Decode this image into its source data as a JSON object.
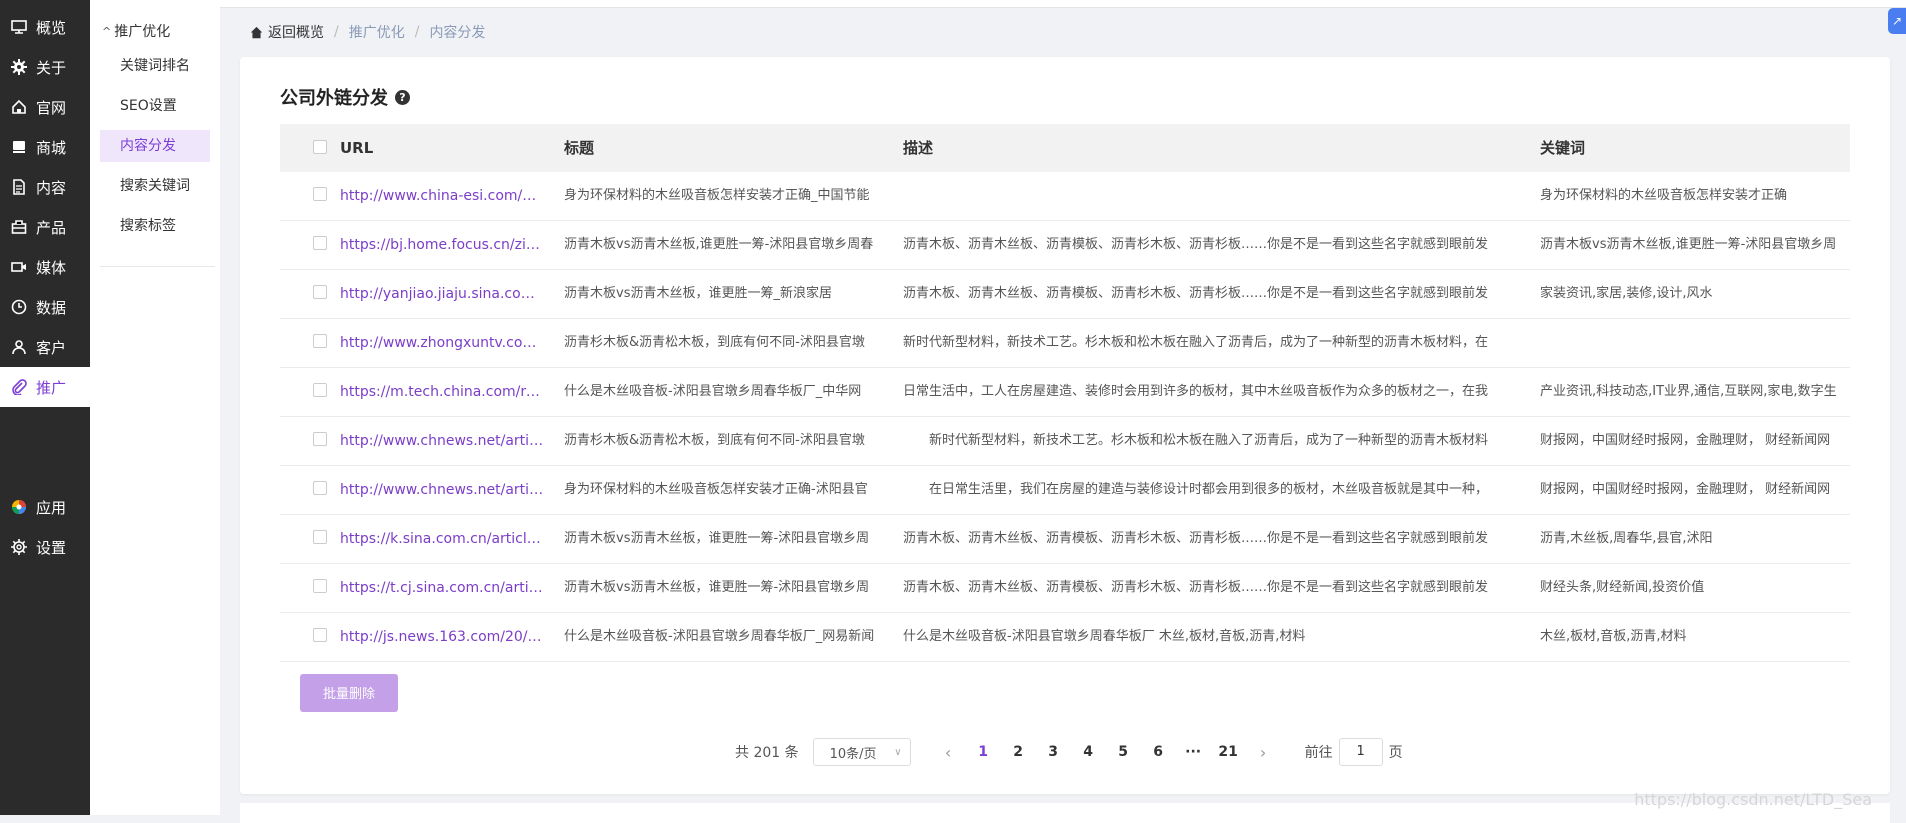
{
  "sidebar": {
    "items": [
      {
        "label": "概览",
        "icon": "dashboard-icon"
      },
      {
        "label": "关于",
        "icon": "gear-icon"
      },
      {
        "label": "官网",
        "icon": "home-icon"
      },
      {
        "label": "商城",
        "icon": "shop-icon"
      },
      {
        "label": "内容",
        "icon": "document-icon"
      },
      {
        "label": "产品",
        "icon": "product-icon"
      },
      {
        "label": "媒体",
        "icon": "video-icon"
      },
      {
        "label": "数据",
        "icon": "clock-icon"
      },
      {
        "label": "客户",
        "icon": "user-icon"
      },
      {
        "label": "推广",
        "icon": "paperclip-icon"
      }
    ],
    "bottom_items": [
      {
        "label": "应用",
        "icon": "apps-icon"
      },
      {
        "label": "设置",
        "icon": "settings-icon"
      }
    ]
  },
  "subnav": {
    "title": "推广优化",
    "items": [
      "关键词排名",
      "SEO设置",
      "内容分发",
      "搜索关键词",
      "搜索标签"
    ]
  },
  "breadcrumb": {
    "home": "返回概览",
    "level1": "推广优化",
    "level2": "内容分发"
  },
  "card": {
    "title": "公司外链分发"
  },
  "table": {
    "headers": {
      "url": "URL",
      "title": "标题",
      "desc": "描述",
      "keywords": "关键词"
    },
    "rows": [
      {
        "url": "http://www.china-esi.com/N...",
        "title": "身为环保材料的木丝吸音板怎样安装才正确_中国节能",
        "desc": "",
        "keywords": "身为环保材料的木丝吸音板怎样安装才正确"
      },
      {
        "url": "https://bj.home.focus.cn/zix...",
        "title": "沥青木板vs沥青木丝板,谁更胜一筹-沭阳县官墩乡周春",
        "desc": "沥青木板、沥青木丝板、沥青模板、沥青杉木板、沥青杉板……你是不是一看到这些名字就感到眼前发",
        "keywords": "沥青木板vs沥青木丝板,谁更胜一筹-沭阳县官墩乡周"
      },
      {
        "url": "http://yanjiao.jiaju.sina.com....",
        "title": "沥青木板vs沥青木丝板，谁更胜一筹_新浪家居",
        "desc": "沥青木板、沥青木丝板、沥青模板、沥青杉木板、沥青杉板……你是不是一看到这些名字就感到眼前发",
        "keywords": "家装资讯,家居,装修,设计,风水"
      },
      {
        "url": "http://www.zhongxuntv.com....",
        "title": "沥青杉木板&沥青松木板，到底有何不同-沭阳县官墩",
        "desc": "新时代新型材料，新技术工艺。杉木板和松木板在融入了沥青后，成为了一种新型的沥青木板材料，在",
        "keywords": ""
      },
      {
        "url": "https://m.tech.china.com/re...",
        "title": "什么是木丝吸音板-沭阳县官墩乡周春华板厂_中华网",
        "desc": "日常生活中，工人在房屋建造、装修时会用到许多的板材，其中木丝吸音板作为众多的板材之一，在我",
        "keywords": "产业资讯,科技动态,IT业界,通信,互联网,家电,数字生"
      },
      {
        "url": "http://www.chnews.net/artic...",
        "title": "沥青杉木板&沥青松木板，到底有何不同-沭阳县官墩",
        "desc": "　　新时代新型材料，新技术工艺。杉木板和松木板在融入了沥青后，成为了一种新型的沥青木板材料",
        "keywords": "财报网，中国财经时报网，金融理财， 财经新闻网"
      },
      {
        "url": "http://www.chnews.net/artic...",
        "title": "身为环保材料的木丝吸音板怎样安装才正确-沭阳县官",
        "desc": "　　在日常生活里，我们在房屋的建造与装修设计时都会用到很多的板材，木丝吸音板就是其中一种，",
        "keywords": "财报网，中国财经时报网，金融理财， 财经新闻网"
      },
      {
        "url": "https://k.sina.com.cn/article_...",
        "title": "沥青木板vs沥青木丝板，谁更胜一筹-沭阳县官墩乡周",
        "desc": "沥青木板、沥青木丝板、沥青模板、沥青杉木板、沥青杉板……你是不是一看到这些名字就感到眼前发",
        "keywords": "沥青,木丝板,周春华,县官,沭阳"
      },
      {
        "url": "https://t.cj.sina.com.cn/articl...",
        "title": "沥青木板vs沥青木丝板，谁更胜一筹-沭阳县官墩乡周",
        "desc": "沥青木板、沥青木丝板、沥青模板、沥青杉木板、沥青杉板……你是不是一看到这些名字就感到眼前发",
        "keywords": "财经头条,财经新闻,投资价值"
      },
      {
        "url": "http://js.news.163.com/20/0...",
        "title": "什么是木丝吸音板-沭阳县官墩乡周春华板厂_网易新闻",
        "desc": "什么是木丝吸音板-沭阳县官墩乡周春华板厂 木丝,板材,音板,沥青,材料",
        "keywords": "木丝,板材,音板,沥青,材料"
      }
    ]
  },
  "actions": {
    "batch_delete": "批量删除"
  },
  "pagination": {
    "total": "共 201 条",
    "page_size": "10条/页",
    "pages": [
      "1",
      "2",
      "3",
      "4",
      "5",
      "6",
      "···",
      "21"
    ],
    "current": "1",
    "goto_label": "前往",
    "goto_value": "1",
    "page_unit": "页"
  },
  "watermark": "https://blog.csdn.net/LTD_Sea",
  "colors": {
    "accent": "#7c3fd6",
    "sidebar_bg": "#2b2b2b",
    "button": "#c3a0e8"
  }
}
